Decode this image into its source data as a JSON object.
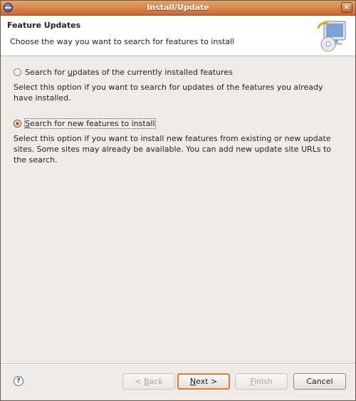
{
  "window": {
    "title": "Install/Update",
    "close_glyph": "×"
  },
  "header": {
    "title": "Feature Updates",
    "description": "Choose the way you want to search for features to install",
    "icon": "install-update-wizard-icon"
  },
  "options": [
    {
      "label_pre": "Search for ",
      "label_mnemonic": "u",
      "label_post": "pdates of the currently installed features",
      "selected": false,
      "description": "Select this option if you want to search for updates of the features you already have installed."
    },
    {
      "label_pre": "",
      "label_mnemonic": "S",
      "label_post": "earch for new features to install",
      "selected": true,
      "description": "Select this option if you want to install new features from existing or new update sites. Some sites may already be available. You can add new update site URLs to the search."
    }
  ],
  "footer": {
    "help_glyph": "?",
    "back": {
      "pre": "< ",
      "mn": "B",
      "post": "ack",
      "enabled": false
    },
    "next": {
      "pre": "",
      "mn": "N",
      "post": "ext >",
      "enabled": true
    },
    "finish": {
      "pre": "",
      "mn": "F",
      "post": "inish",
      "enabled": false
    },
    "cancel": {
      "label": "Cancel",
      "enabled": true
    }
  },
  "colors": {
    "titlebar": "#c9672f",
    "accent": "#e07b3a",
    "background": "#efebe7"
  }
}
